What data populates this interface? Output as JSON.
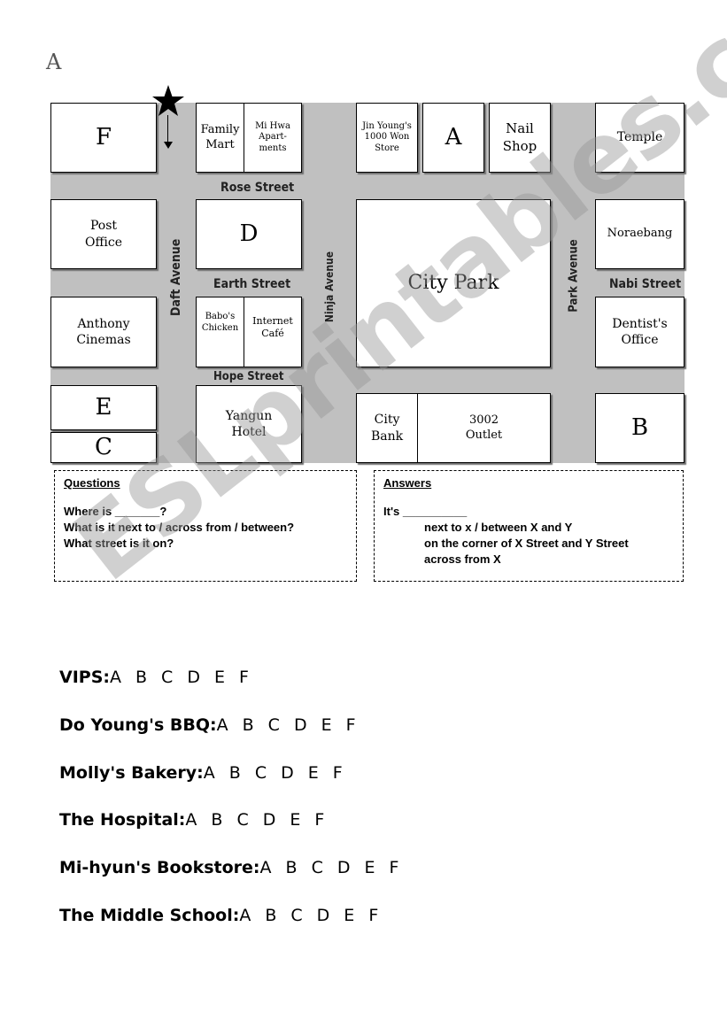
{
  "page_label": "A",
  "map": {
    "blocks": {
      "f": "F",
      "family_mart": "Family Mart",
      "mi_hwa": "Mi Hwa Apart-ments",
      "jin_youngs": "Jin Young's 1000 Won Store",
      "a": "A",
      "nail_shop": "Nail Shop",
      "temple": "Temple",
      "post_office": "Post Office",
      "d": "D",
      "city_park": "City Park",
      "noraebang": "Noraebang",
      "anthony_cinemas": "Anthony Cinemas",
      "babos_chicken": "Babo's Chicken",
      "internet_cafe": "Internet Café",
      "dentists_office": "Dentist's Office",
      "e": "E",
      "c": "C",
      "yangun_hotel": "Yangun Hotel",
      "city_bank": "City Bank",
      "outlet": "3002 Outlet",
      "b": "B"
    },
    "streets": {
      "rose": "Rose Street",
      "earth": "Earth Street",
      "hope": "Hope Street",
      "nabi": "Nabi Street",
      "daft": "Daft Avenue",
      "ninja": "Ninja Avenue",
      "park": "Park Avenue"
    },
    "start_marker": "star-icon"
  },
  "questions": {
    "title": "Questions",
    "lines": [
      "Where is _______?",
      "What is it next to / across from / between?",
      "What street is it on?"
    ]
  },
  "answers": {
    "title": "Answers",
    "lines": [
      "It's __________",
      "next to x / between X and Y",
      "on the corner of X Street and Y Street",
      "across from X"
    ]
  },
  "quiz": {
    "options": [
      "A",
      "B",
      "C",
      "D",
      "E",
      "F"
    ],
    "items": [
      "VIPS:",
      "Do Young's BBQ:",
      "Molly's Bakery:",
      "The Hospital:",
      "Mi-hyun's Bookstore:",
      "The Middle School:"
    ]
  },
  "watermark": "ESLprintables.com"
}
